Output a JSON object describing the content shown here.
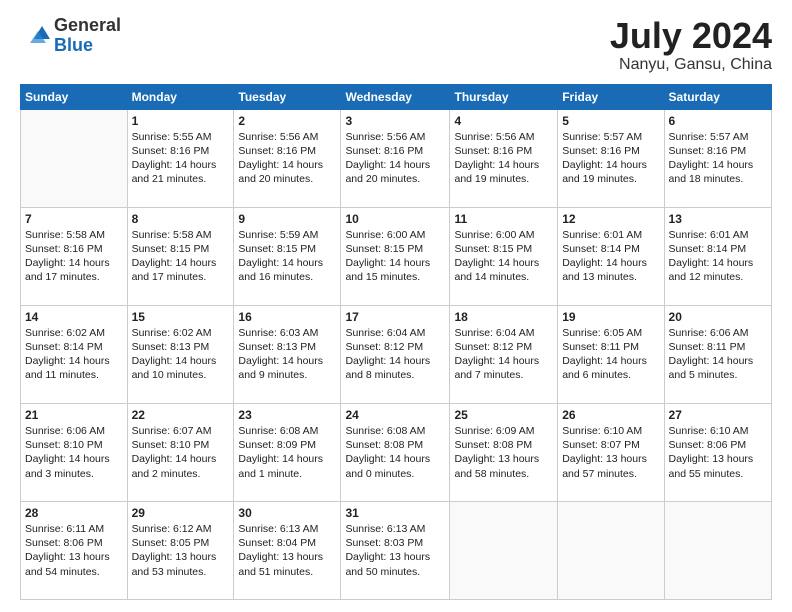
{
  "logo": {
    "general": "General",
    "blue": "Blue"
  },
  "header": {
    "month_year": "July 2024",
    "location": "Nanyu, Gansu, China"
  },
  "weekdays": [
    "Sunday",
    "Monday",
    "Tuesday",
    "Wednesday",
    "Thursday",
    "Friday",
    "Saturday"
  ],
  "weeks": [
    [
      {
        "day": "",
        "content": ""
      },
      {
        "day": "1",
        "content": "Sunrise: 5:55 AM\nSunset: 8:16 PM\nDaylight: 14 hours\nand 21 minutes."
      },
      {
        "day": "2",
        "content": "Sunrise: 5:56 AM\nSunset: 8:16 PM\nDaylight: 14 hours\nand 20 minutes."
      },
      {
        "day": "3",
        "content": "Sunrise: 5:56 AM\nSunset: 8:16 PM\nDaylight: 14 hours\nand 20 minutes."
      },
      {
        "day": "4",
        "content": "Sunrise: 5:56 AM\nSunset: 8:16 PM\nDaylight: 14 hours\nand 19 minutes."
      },
      {
        "day": "5",
        "content": "Sunrise: 5:57 AM\nSunset: 8:16 PM\nDaylight: 14 hours\nand 19 minutes."
      },
      {
        "day": "6",
        "content": "Sunrise: 5:57 AM\nSunset: 8:16 PM\nDaylight: 14 hours\nand 18 minutes."
      }
    ],
    [
      {
        "day": "7",
        "content": "Sunrise: 5:58 AM\nSunset: 8:16 PM\nDaylight: 14 hours\nand 17 minutes."
      },
      {
        "day": "8",
        "content": "Sunrise: 5:58 AM\nSunset: 8:15 PM\nDaylight: 14 hours\nand 17 minutes."
      },
      {
        "day": "9",
        "content": "Sunrise: 5:59 AM\nSunset: 8:15 PM\nDaylight: 14 hours\nand 16 minutes."
      },
      {
        "day": "10",
        "content": "Sunrise: 6:00 AM\nSunset: 8:15 PM\nDaylight: 14 hours\nand 15 minutes."
      },
      {
        "day": "11",
        "content": "Sunrise: 6:00 AM\nSunset: 8:15 PM\nDaylight: 14 hours\nand 14 minutes."
      },
      {
        "day": "12",
        "content": "Sunrise: 6:01 AM\nSunset: 8:14 PM\nDaylight: 14 hours\nand 13 minutes."
      },
      {
        "day": "13",
        "content": "Sunrise: 6:01 AM\nSunset: 8:14 PM\nDaylight: 14 hours\nand 12 minutes."
      }
    ],
    [
      {
        "day": "14",
        "content": "Sunrise: 6:02 AM\nSunset: 8:14 PM\nDaylight: 14 hours\nand 11 minutes."
      },
      {
        "day": "15",
        "content": "Sunrise: 6:02 AM\nSunset: 8:13 PM\nDaylight: 14 hours\nand 10 minutes."
      },
      {
        "day": "16",
        "content": "Sunrise: 6:03 AM\nSunset: 8:13 PM\nDaylight: 14 hours\nand 9 minutes."
      },
      {
        "day": "17",
        "content": "Sunrise: 6:04 AM\nSunset: 8:12 PM\nDaylight: 14 hours\nand 8 minutes."
      },
      {
        "day": "18",
        "content": "Sunrise: 6:04 AM\nSunset: 8:12 PM\nDaylight: 14 hours\nand 7 minutes."
      },
      {
        "day": "19",
        "content": "Sunrise: 6:05 AM\nSunset: 8:11 PM\nDaylight: 14 hours\nand 6 minutes."
      },
      {
        "day": "20",
        "content": "Sunrise: 6:06 AM\nSunset: 8:11 PM\nDaylight: 14 hours\nand 5 minutes."
      }
    ],
    [
      {
        "day": "21",
        "content": "Sunrise: 6:06 AM\nSunset: 8:10 PM\nDaylight: 14 hours\nand 3 minutes."
      },
      {
        "day": "22",
        "content": "Sunrise: 6:07 AM\nSunset: 8:10 PM\nDaylight: 14 hours\nand 2 minutes."
      },
      {
        "day": "23",
        "content": "Sunrise: 6:08 AM\nSunset: 8:09 PM\nDaylight: 14 hours\nand 1 minute."
      },
      {
        "day": "24",
        "content": "Sunrise: 6:08 AM\nSunset: 8:08 PM\nDaylight: 14 hours\nand 0 minutes."
      },
      {
        "day": "25",
        "content": "Sunrise: 6:09 AM\nSunset: 8:08 PM\nDaylight: 13 hours\nand 58 minutes."
      },
      {
        "day": "26",
        "content": "Sunrise: 6:10 AM\nSunset: 8:07 PM\nDaylight: 13 hours\nand 57 minutes."
      },
      {
        "day": "27",
        "content": "Sunrise: 6:10 AM\nSunset: 8:06 PM\nDaylight: 13 hours\nand 55 minutes."
      }
    ],
    [
      {
        "day": "28",
        "content": "Sunrise: 6:11 AM\nSunset: 8:06 PM\nDaylight: 13 hours\nand 54 minutes."
      },
      {
        "day": "29",
        "content": "Sunrise: 6:12 AM\nSunset: 8:05 PM\nDaylight: 13 hours\nand 53 minutes."
      },
      {
        "day": "30",
        "content": "Sunrise: 6:13 AM\nSunset: 8:04 PM\nDaylight: 13 hours\nand 51 minutes."
      },
      {
        "day": "31",
        "content": "Sunrise: 6:13 AM\nSunset: 8:03 PM\nDaylight: 13 hours\nand 50 minutes."
      },
      {
        "day": "",
        "content": ""
      },
      {
        "day": "",
        "content": ""
      },
      {
        "day": "",
        "content": ""
      }
    ]
  ]
}
